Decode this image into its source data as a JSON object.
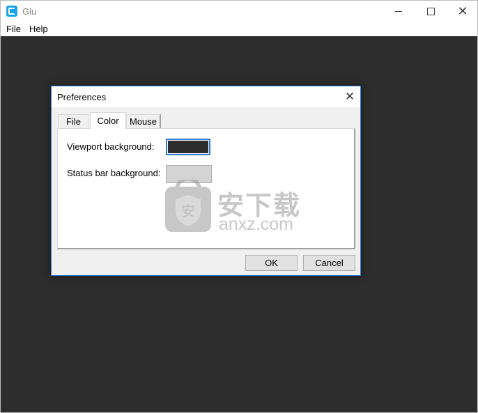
{
  "window": {
    "title": "Glu",
    "controls": {
      "minimize": "minimize",
      "maximize": "maximize",
      "close": "✕"
    }
  },
  "menu": {
    "items": [
      {
        "label": "File"
      },
      {
        "label": "Help"
      }
    ]
  },
  "viewport": {
    "background_color": "#2d2d2d"
  },
  "dialog": {
    "title": "Preferences",
    "close_glyph": "✕",
    "tabs": [
      {
        "label": "File",
        "selected": false
      },
      {
        "label": "Color",
        "selected": true
      },
      {
        "label": "Mouse",
        "selected": false
      }
    ],
    "fields": {
      "viewport_background_label": "Viewport background:",
      "viewport_background_color": "#2d2d2d",
      "status_bar_background_label": "Status bar background:",
      "status_bar_background_color": "#d4d4d4"
    },
    "buttons": {
      "ok": "OK",
      "cancel": "Cancel"
    }
  },
  "watermark": {
    "cn_text": "安下载",
    "en_text": "anxz.com",
    "shield_text": "安"
  },
  "colors": {
    "accent": "#2e7cd3",
    "app_icon": "#1aa3e8"
  }
}
